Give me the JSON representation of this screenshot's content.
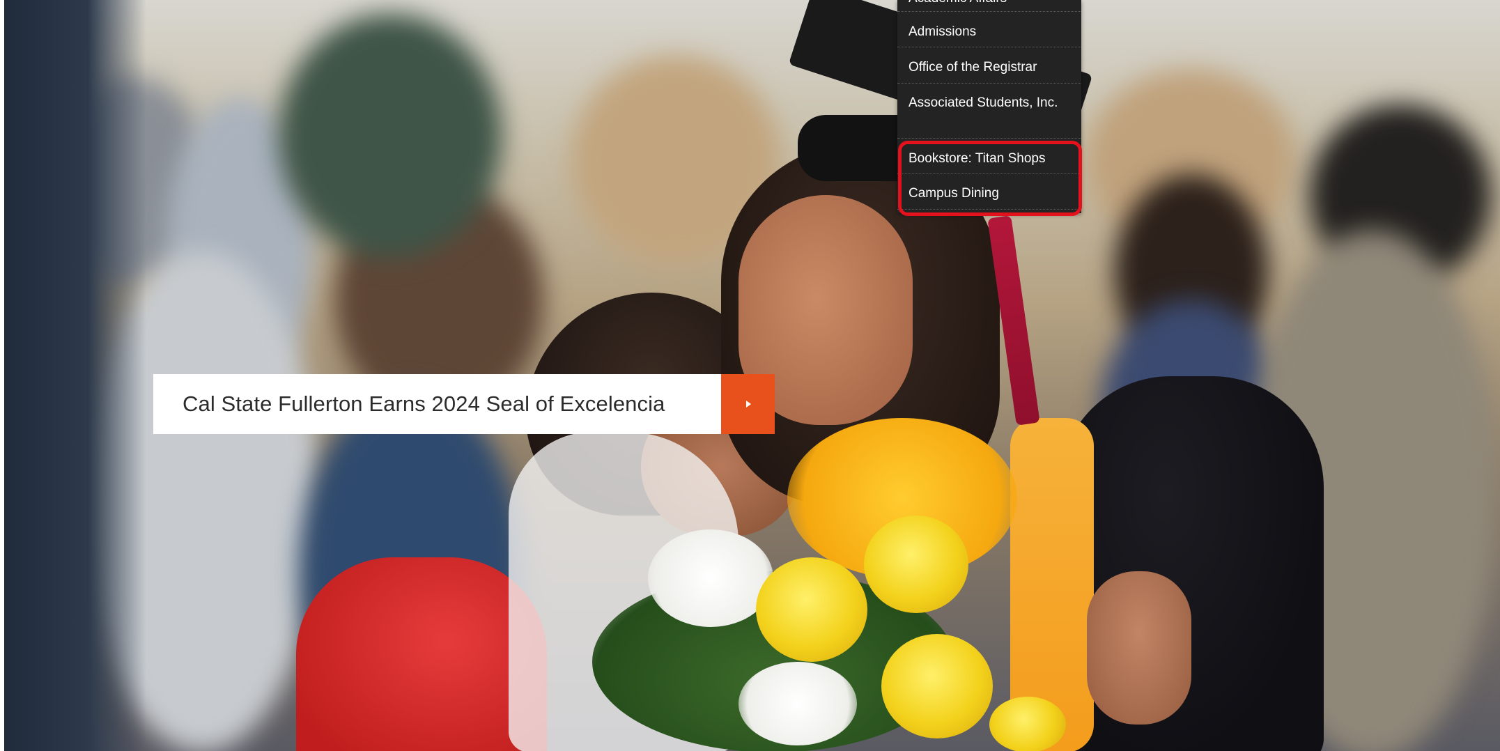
{
  "headline": {
    "text": "Cal State Fullerton Earns 2024 Seal of Excelencia",
    "button_icon": "play-right-icon",
    "button_color": "#e8501c"
  },
  "dropdown": {
    "items": [
      {
        "label": "Academic Affairs"
      },
      {
        "label": "Admissions"
      },
      {
        "label": "Office of the Registrar"
      },
      {
        "label": "Associated Students, Inc."
      },
      {
        "label": "Bookstore: Titan Shops"
      },
      {
        "label": "Campus Dining"
      }
    ],
    "background": "#232323",
    "highlight_color": "#e4121d"
  }
}
